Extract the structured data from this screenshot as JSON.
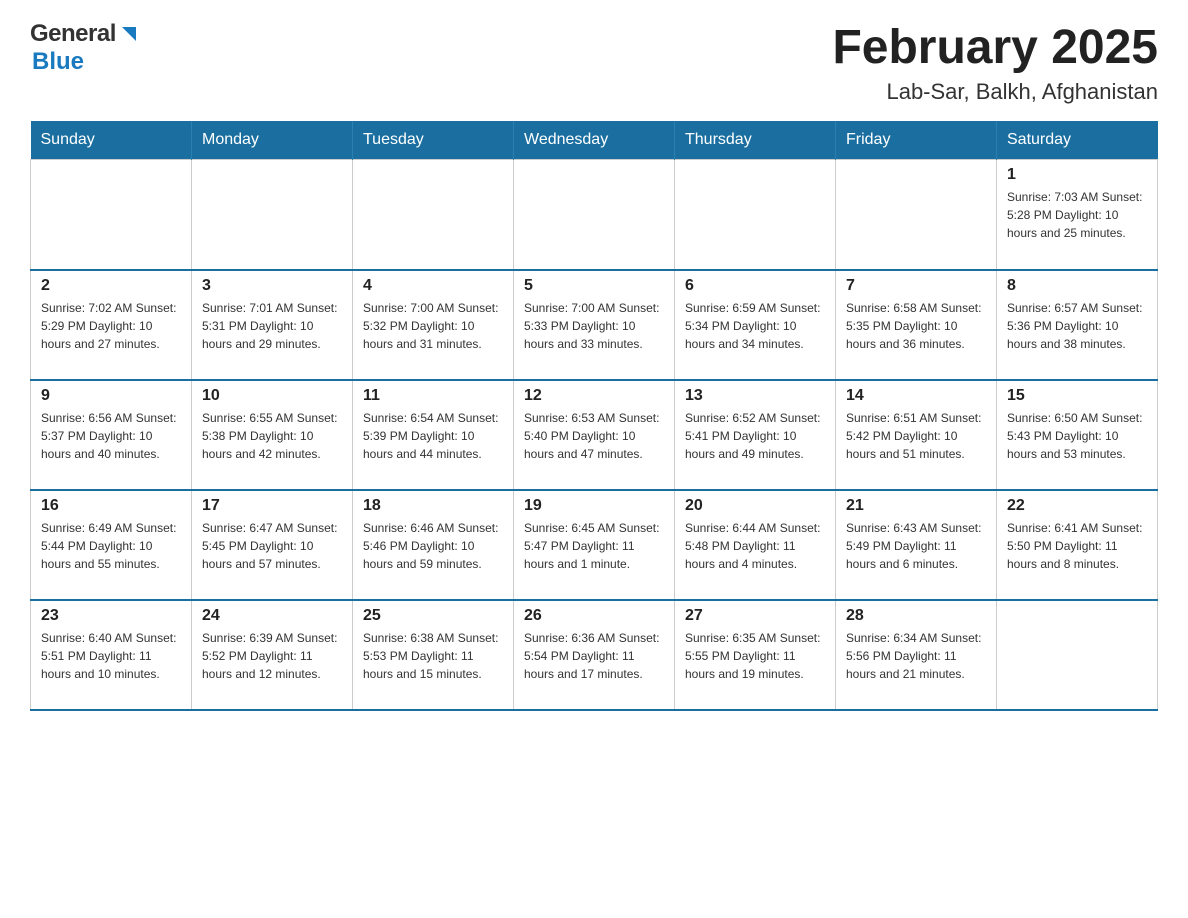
{
  "header": {
    "logo_general": "General",
    "logo_blue": "Blue",
    "title": "February 2025",
    "subtitle": "Lab-Sar, Balkh, Afghanistan"
  },
  "weekdays": [
    "Sunday",
    "Monday",
    "Tuesday",
    "Wednesday",
    "Thursday",
    "Friday",
    "Saturday"
  ],
  "weeks": [
    [
      {
        "day": "",
        "info": ""
      },
      {
        "day": "",
        "info": ""
      },
      {
        "day": "",
        "info": ""
      },
      {
        "day": "",
        "info": ""
      },
      {
        "day": "",
        "info": ""
      },
      {
        "day": "",
        "info": ""
      },
      {
        "day": "1",
        "info": "Sunrise: 7:03 AM\nSunset: 5:28 PM\nDaylight: 10 hours and 25 minutes."
      }
    ],
    [
      {
        "day": "2",
        "info": "Sunrise: 7:02 AM\nSunset: 5:29 PM\nDaylight: 10 hours and 27 minutes."
      },
      {
        "day": "3",
        "info": "Sunrise: 7:01 AM\nSunset: 5:31 PM\nDaylight: 10 hours and 29 minutes."
      },
      {
        "day": "4",
        "info": "Sunrise: 7:00 AM\nSunset: 5:32 PM\nDaylight: 10 hours and 31 minutes."
      },
      {
        "day": "5",
        "info": "Sunrise: 7:00 AM\nSunset: 5:33 PM\nDaylight: 10 hours and 33 minutes."
      },
      {
        "day": "6",
        "info": "Sunrise: 6:59 AM\nSunset: 5:34 PM\nDaylight: 10 hours and 34 minutes."
      },
      {
        "day": "7",
        "info": "Sunrise: 6:58 AM\nSunset: 5:35 PM\nDaylight: 10 hours and 36 minutes."
      },
      {
        "day": "8",
        "info": "Sunrise: 6:57 AM\nSunset: 5:36 PM\nDaylight: 10 hours and 38 minutes."
      }
    ],
    [
      {
        "day": "9",
        "info": "Sunrise: 6:56 AM\nSunset: 5:37 PM\nDaylight: 10 hours and 40 minutes."
      },
      {
        "day": "10",
        "info": "Sunrise: 6:55 AM\nSunset: 5:38 PM\nDaylight: 10 hours and 42 minutes."
      },
      {
        "day": "11",
        "info": "Sunrise: 6:54 AM\nSunset: 5:39 PM\nDaylight: 10 hours and 44 minutes."
      },
      {
        "day": "12",
        "info": "Sunrise: 6:53 AM\nSunset: 5:40 PM\nDaylight: 10 hours and 47 minutes."
      },
      {
        "day": "13",
        "info": "Sunrise: 6:52 AM\nSunset: 5:41 PM\nDaylight: 10 hours and 49 minutes."
      },
      {
        "day": "14",
        "info": "Sunrise: 6:51 AM\nSunset: 5:42 PM\nDaylight: 10 hours and 51 minutes."
      },
      {
        "day": "15",
        "info": "Sunrise: 6:50 AM\nSunset: 5:43 PM\nDaylight: 10 hours and 53 minutes."
      }
    ],
    [
      {
        "day": "16",
        "info": "Sunrise: 6:49 AM\nSunset: 5:44 PM\nDaylight: 10 hours and 55 minutes."
      },
      {
        "day": "17",
        "info": "Sunrise: 6:47 AM\nSunset: 5:45 PM\nDaylight: 10 hours and 57 minutes."
      },
      {
        "day": "18",
        "info": "Sunrise: 6:46 AM\nSunset: 5:46 PM\nDaylight: 10 hours and 59 minutes."
      },
      {
        "day": "19",
        "info": "Sunrise: 6:45 AM\nSunset: 5:47 PM\nDaylight: 11 hours and 1 minute."
      },
      {
        "day": "20",
        "info": "Sunrise: 6:44 AM\nSunset: 5:48 PM\nDaylight: 11 hours and 4 minutes."
      },
      {
        "day": "21",
        "info": "Sunrise: 6:43 AM\nSunset: 5:49 PM\nDaylight: 11 hours and 6 minutes."
      },
      {
        "day": "22",
        "info": "Sunrise: 6:41 AM\nSunset: 5:50 PM\nDaylight: 11 hours and 8 minutes."
      }
    ],
    [
      {
        "day": "23",
        "info": "Sunrise: 6:40 AM\nSunset: 5:51 PM\nDaylight: 11 hours and 10 minutes."
      },
      {
        "day": "24",
        "info": "Sunrise: 6:39 AM\nSunset: 5:52 PM\nDaylight: 11 hours and 12 minutes."
      },
      {
        "day": "25",
        "info": "Sunrise: 6:38 AM\nSunset: 5:53 PM\nDaylight: 11 hours and 15 minutes."
      },
      {
        "day": "26",
        "info": "Sunrise: 6:36 AM\nSunset: 5:54 PM\nDaylight: 11 hours and 17 minutes."
      },
      {
        "day": "27",
        "info": "Sunrise: 6:35 AM\nSunset: 5:55 PM\nDaylight: 11 hours and 19 minutes."
      },
      {
        "day": "28",
        "info": "Sunrise: 6:34 AM\nSunset: 5:56 PM\nDaylight: 11 hours and 21 minutes."
      },
      {
        "day": "",
        "info": ""
      }
    ]
  ]
}
